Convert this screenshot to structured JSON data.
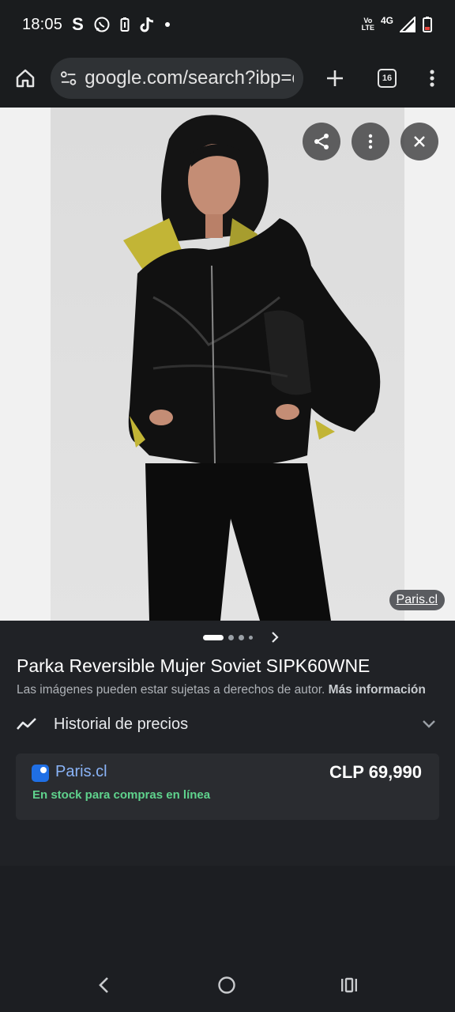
{
  "status_bar": {
    "time": "18:05",
    "app_icons": [
      "s-icon",
      "whatsapp-icon",
      "battery-saver-icon",
      "tiktok-icon",
      "dot-icon"
    ],
    "network_top": "Vo",
    "network_bottom": "LTE",
    "network_type": "4G"
  },
  "browser": {
    "url": "google.com/search?ibp=c",
    "tab_count": "16"
  },
  "image_viewer": {
    "source_label": "Paris.cl",
    "pager": {
      "total": 4,
      "active": 1
    }
  },
  "product": {
    "title": "Parka Reversible Mujer Soviet SIPK60WNE",
    "copyright_text": "Las imágenes pueden estar sujetas a derechos de autor.",
    "more_info_label": "Más información",
    "price_history_label": "Historial de precios"
  },
  "offer": {
    "store_name": "Paris.cl",
    "price": "CLP 69,990",
    "stock_status": "En stock para compras en línea"
  },
  "colors": {
    "accent_link": "#8ab4f8",
    "stock_green": "#5fd38d",
    "panel_bg": "#202226"
  }
}
